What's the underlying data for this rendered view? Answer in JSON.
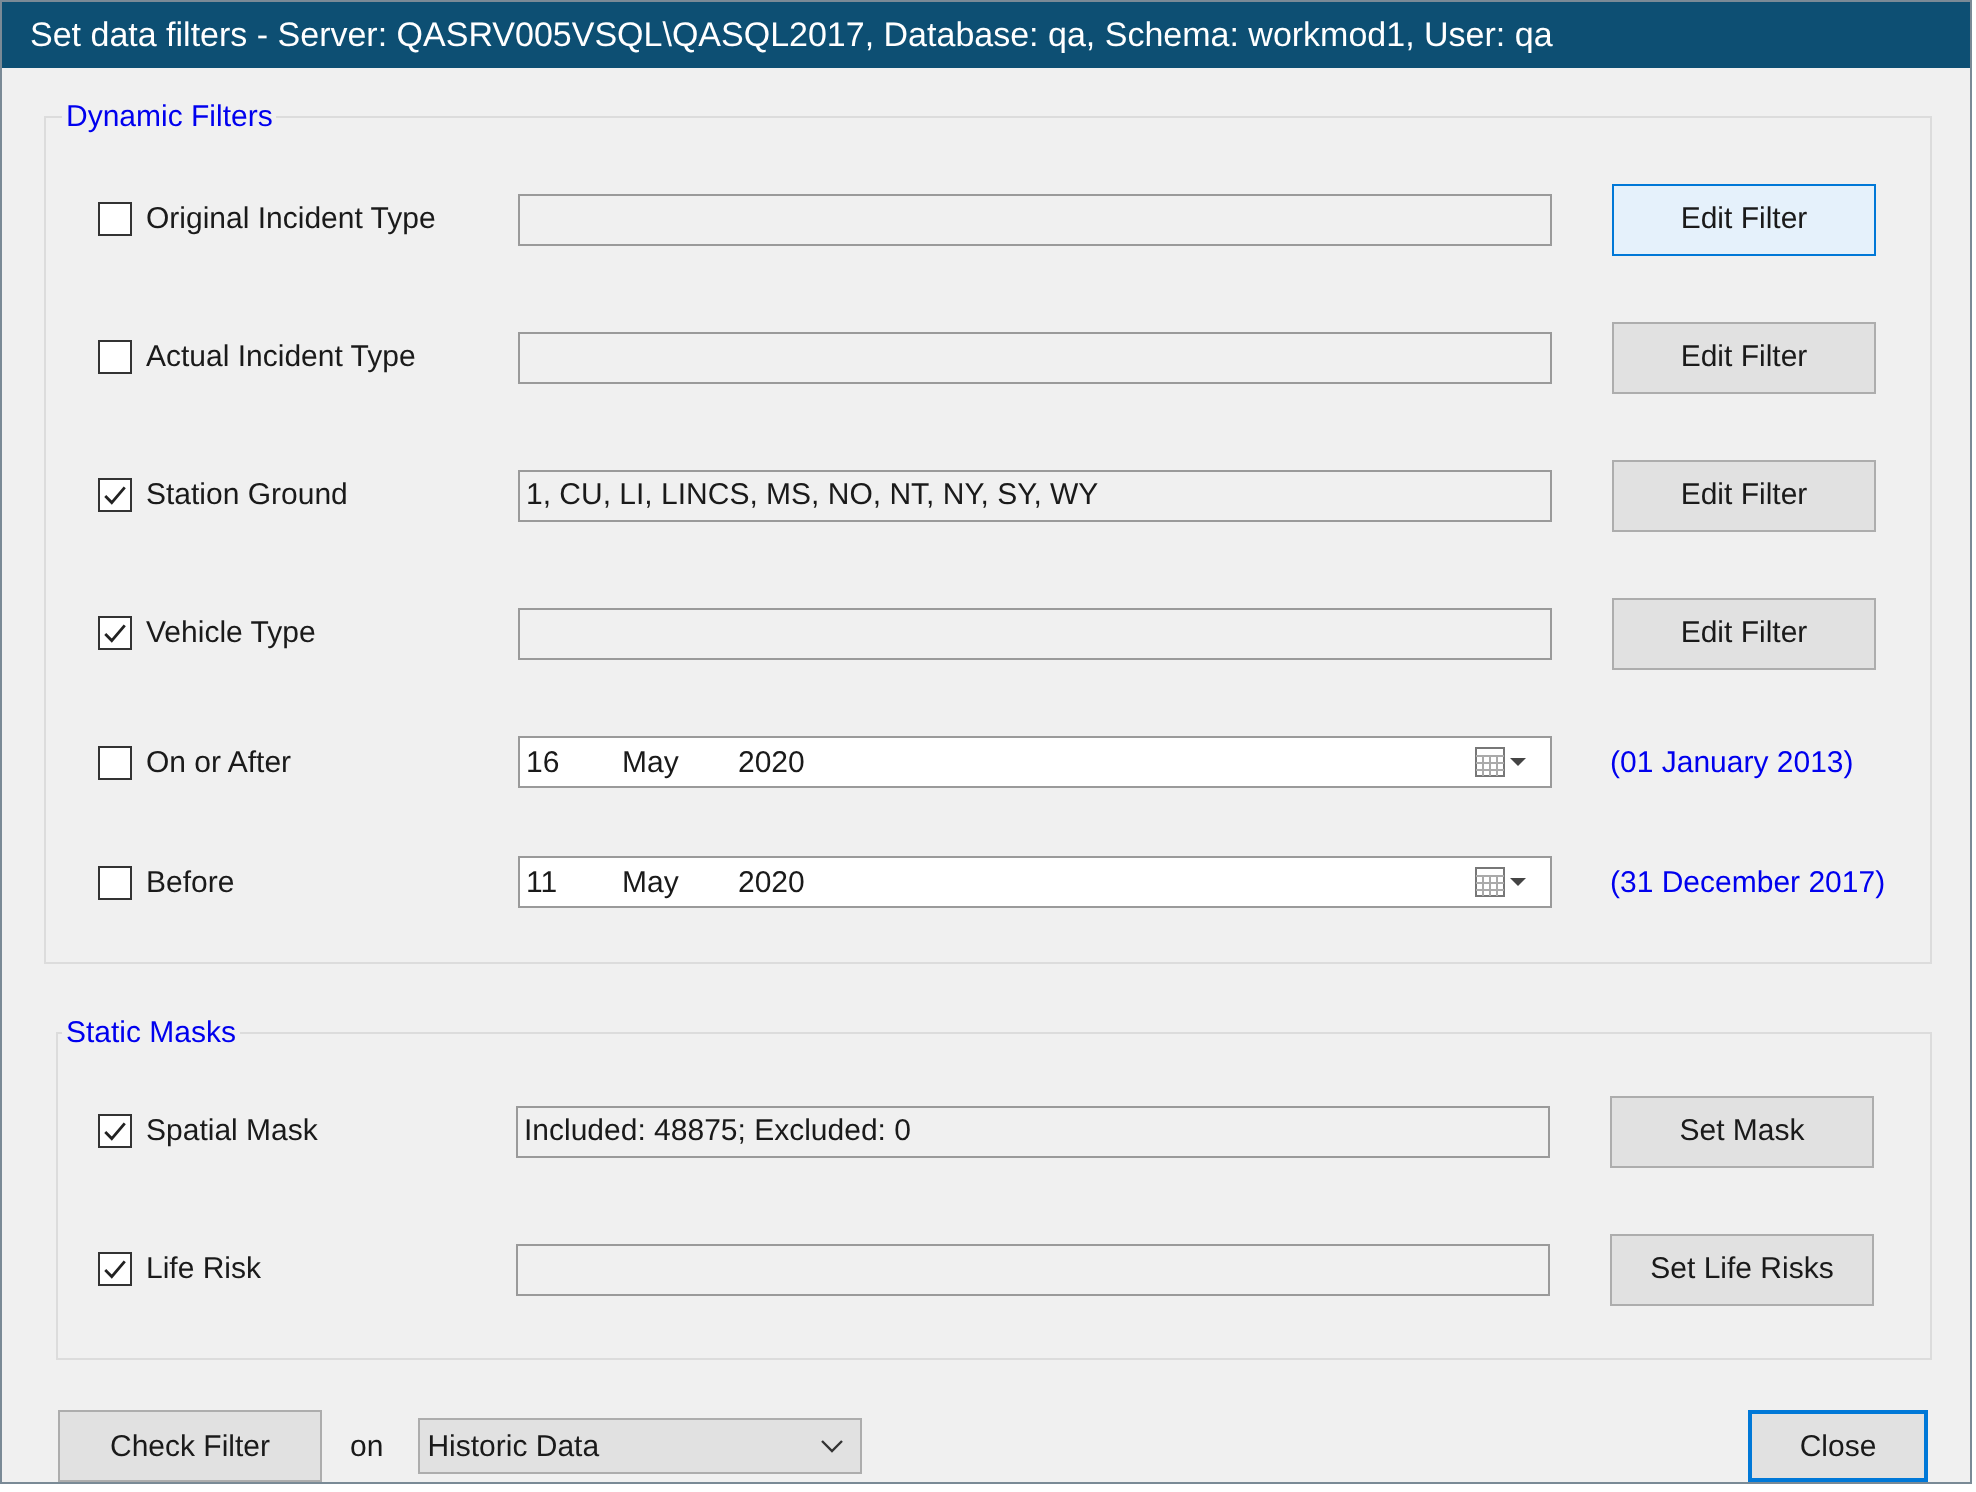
{
  "window": {
    "title": "Set data filters - Server: QASRV005VSQL\\QASQL2017, Database: qa, Schema: workmod1, User: qa"
  },
  "dynamic_filters": {
    "title": "Dynamic Filters",
    "rows": [
      {
        "kind": "text",
        "label": "Original Incident Type",
        "checked": false,
        "button": {
          "label": "Edit Filter",
          "highlighted": true
        }
      },
      {
        "kind": "text",
        "label": "Actual Incident Type",
        "checked": false,
        "button": {
          "label": "Edit Filter",
          "highlighted": false
        }
      },
      {
        "kind": "text",
        "label": "Station Ground",
        "checked": true,
        "value": "1, CU, LI, LINCS, MS, NO, NT, NY, SY, WY",
        "button": {
          "label": "Edit Filter",
          "highlighted": false
        }
      },
      {
        "kind": "text",
        "label": "Vehicle Type",
        "checked": true,
        "button": {
          "label": "Edit Filter",
          "highlighted": false
        }
      },
      {
        "kind": "date",
        "label": "On or After",
        "checked": false,
        "day": "16",
        "month": "May",
        "year": "2020",
        "note": "(01 January 2013)"
      },
      {
        "kind": "date",
        "label": "Before",
        "checked": false,
        "day": "11",
        "month": "May",
        "year": "2020",
        "note": "(31 December 2017)"
      }
    ]
  },
  "static_masks": {
    "title": "Static Masks",
    "rows": [
      {
        "kind": "text",
        "label": "Spatial Mask",
        "checked": true,
        "value": "Included: 48875; Excluded: 0",
        "button": {
          "label": "Set Mask",
          "highlighted": false
        }
      },
      {
        "kind": "text",
        "label": "Life Risk",
        "checked": true,
        "button": {
          "label": "Set Life Risks",
          "highlighted": false
        }
      }
    ]
  },
  "footer": {
    "check_button": "Check Filter",
    "on_label": "on",
    "source": "Historic Data",
    "close_button": "Close"
  }
}
